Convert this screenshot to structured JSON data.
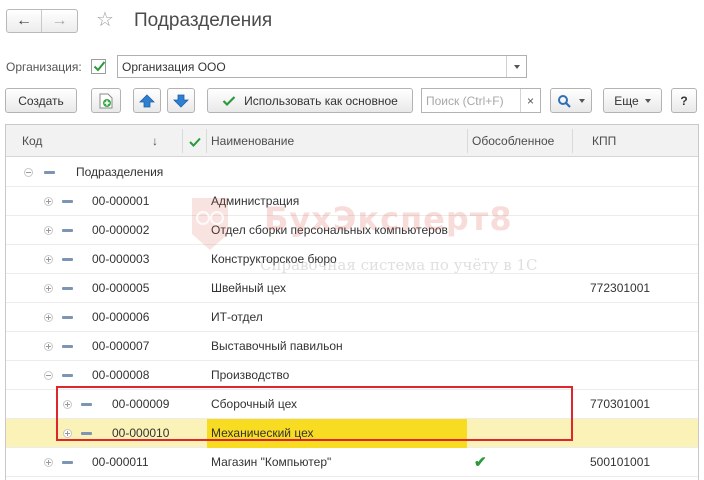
{
  "title": "Подразделения",
  "organization": {
    "label": "Организация:",
    "checked": true,
    "value": "Организация ООО"
  },
  "toolbar": {
    "create_label": "Создать",
    "use_as_default_label": "Использовать как основное",
    "search_placeholder": "Поиск (Ctrl+F)",
    "clear_label": "×",
    "more_label": "Еще",
    "help_label": "?"
  },
  "columns": {
    "code": "Код",
    "sort_arrow": "↓",
    "name": "Наименование",
    "separate": "Обособленное",
    "kpp": "КПП"
  },
  "rows": [
    {
      "code": "",
      "name": "Подразделения",
      "separate": "",
      "kpp": ""
    },
    {
      "code": "00-000001",
      "name": "Администрация",
      "separate": "",
      "kpp": ""
    },
    {
      "code": "00-000002",
      "name": "Отдел сборки персональных компьютеров",
      "separate": "",
      "kpp": ""
    },
    {
      "code": "00-000003",
      "name": "Конструкторское бюро",
      "separate": "",
      "kpp": ""
    },
    {
      "code": "00-000005",
      "name": "Швейный цех",
      "separate": "",
      "kpp": "772301001"
    },
    {
      "code": "00-000006",
      "name": "ИТ-отдел",
      "separate": "",
      "kpp": ""
    },
    {
      "code": "00-000007",
      "name": "Выставочный павильон",
      "separate": "",
      "kpp": ""
    },
    {
      "code": "00-000008",
      "name": "Производство",
      "separate": "",
      "kpp": ""
    },
    {
      "code": "00-000009",
      "name": "Сборочный цех",
      "separate": "",
      "kpp": "770301001"
    },
    {
      "code": "00-000010",
      "name": "Механический цех",
      "separate": "",
      "kpp": ""
    },
    {
      "code": "00-000011",
      "name": "Магазин \"Компьютер\"",
      "separate": "✔",
      "kpp": "500101001"
    }
  ],
  "watermark": {
    "brand": "БухЭксперт8",
    "tagline": "Справочная система по учёту в 1С"
  },
  "colors": {
    "selected_row": "#faf2b7",
    "highlight_cell": "#f8dc22",
    "check_green": "#2a9a3a",
    "frame_red": "#e0262d",
    "arrow_blue": "#2f7fd0"
  }
}
